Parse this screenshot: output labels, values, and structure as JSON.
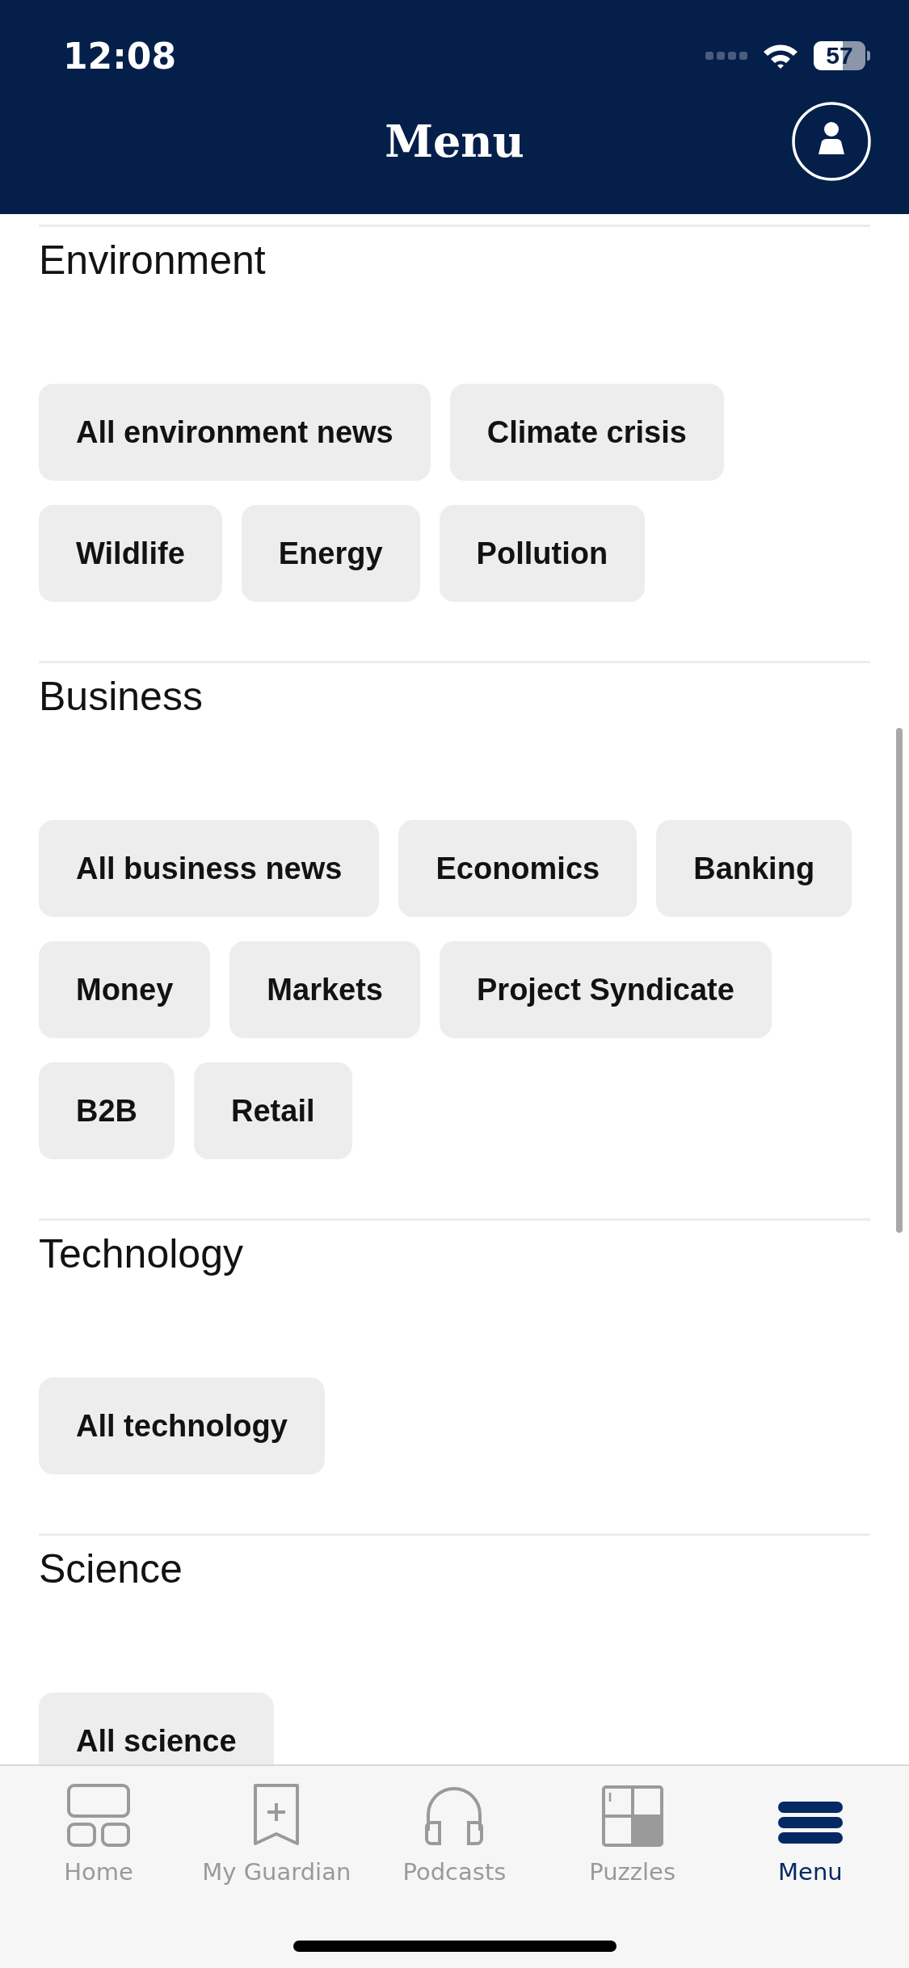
{
  "status_bar": {
    "time": "12:08",
    "battery": "57"
  },
  "header": {
    "title": "Menu"
  },
  "sections": [
    {
      "title": "Environment",
      "chips": [
        "All environment news",
        "Climate crisis",
        "Wildlife",
        "Energy",
        "Pollution"
      ]
    },
    {
      "title": "Business",
      "chips": [
        "All business news",
        "Economics",
        "Banking",
        "Money",
        "Markets",
        "Project Syndicate",
        "B2B",
        "Retail"
      ]
    },
    {
      "title": "Technology",
      "chips": [
        "All technology"
      ]
    },
    {
      "title": "Science",
      "chips": [
        "All science"
      ]
    }
  ],
  "tab_bar": [
    {
      "label": "Home",
      "kind": "home",
      "selected": false
    },
    {
      "label": "My Guardian",
      "kind": "bookmark",
      "selected": false
    },
    {
      "label": "Podcasts",
      "kind": "headphones",
      "selected": false
    },
    {
      "label": "Puzzles",
      "kind": "puzzle",
      "selected": false
    },
    {
      "label": "Menu",
      "kind": "menu",
      "selected": true
    }
  ]
}
